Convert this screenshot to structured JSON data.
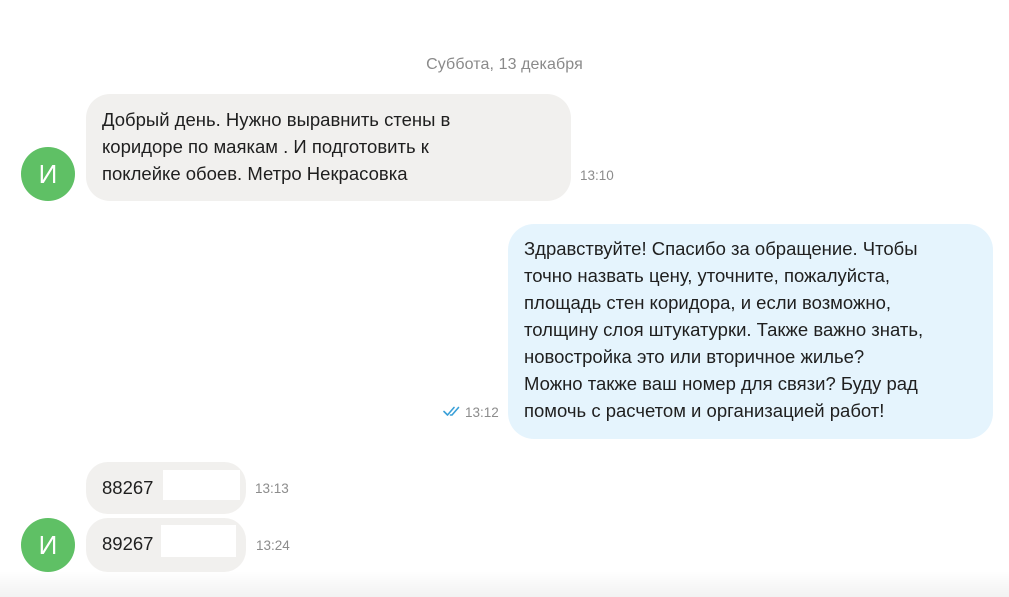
{
  "chat": {
    "date_separator": "Суббота, 13 декабря",
    "avatar_letter": "И",
    "messages": [
      {
        "direction": "incoming",
        "lines": [
          "Добрый день. Нужно выравнить стены в",
          "коридоре по маякам . И подготовить к",
          "поклейке обоев. Метро Некрасовка"
        ],
        "time": "13:10"
      },
      {
        "direction": "outgoing",
        "lines": [
          "Здравствуйте! Спасибо за обращение. Чтобы",
          "точно назвать цену, уточните, пожалуйста,",
          "площадь стен коридора, и если возможно,",
          "толщину слоя штукатурки. Также важно знать,",
          "новостройка это или вторичное жилье?",
          "Можно также ваш номер для связи? Буду рад",
          "помочь с расчетом и организацией работ!"
        ],
        "time": "13:12",
        "status": "read-double-check-icon",
        "status_color": "#3aa0d8"
      },
      {
        "direction": "incoming",
        "text": "88267",
        "time": "13:13"
      },
      {
        "direction": "incoming",
        "text": "89267",
        "time": "13:24"
      }
    ]
  },
  "colors": {
    "incoming_bubble": "#f1f0ee",
    "outgoing_bubble": "#e5f4fd",
    "avatar": "#5fc065"
  }
}
